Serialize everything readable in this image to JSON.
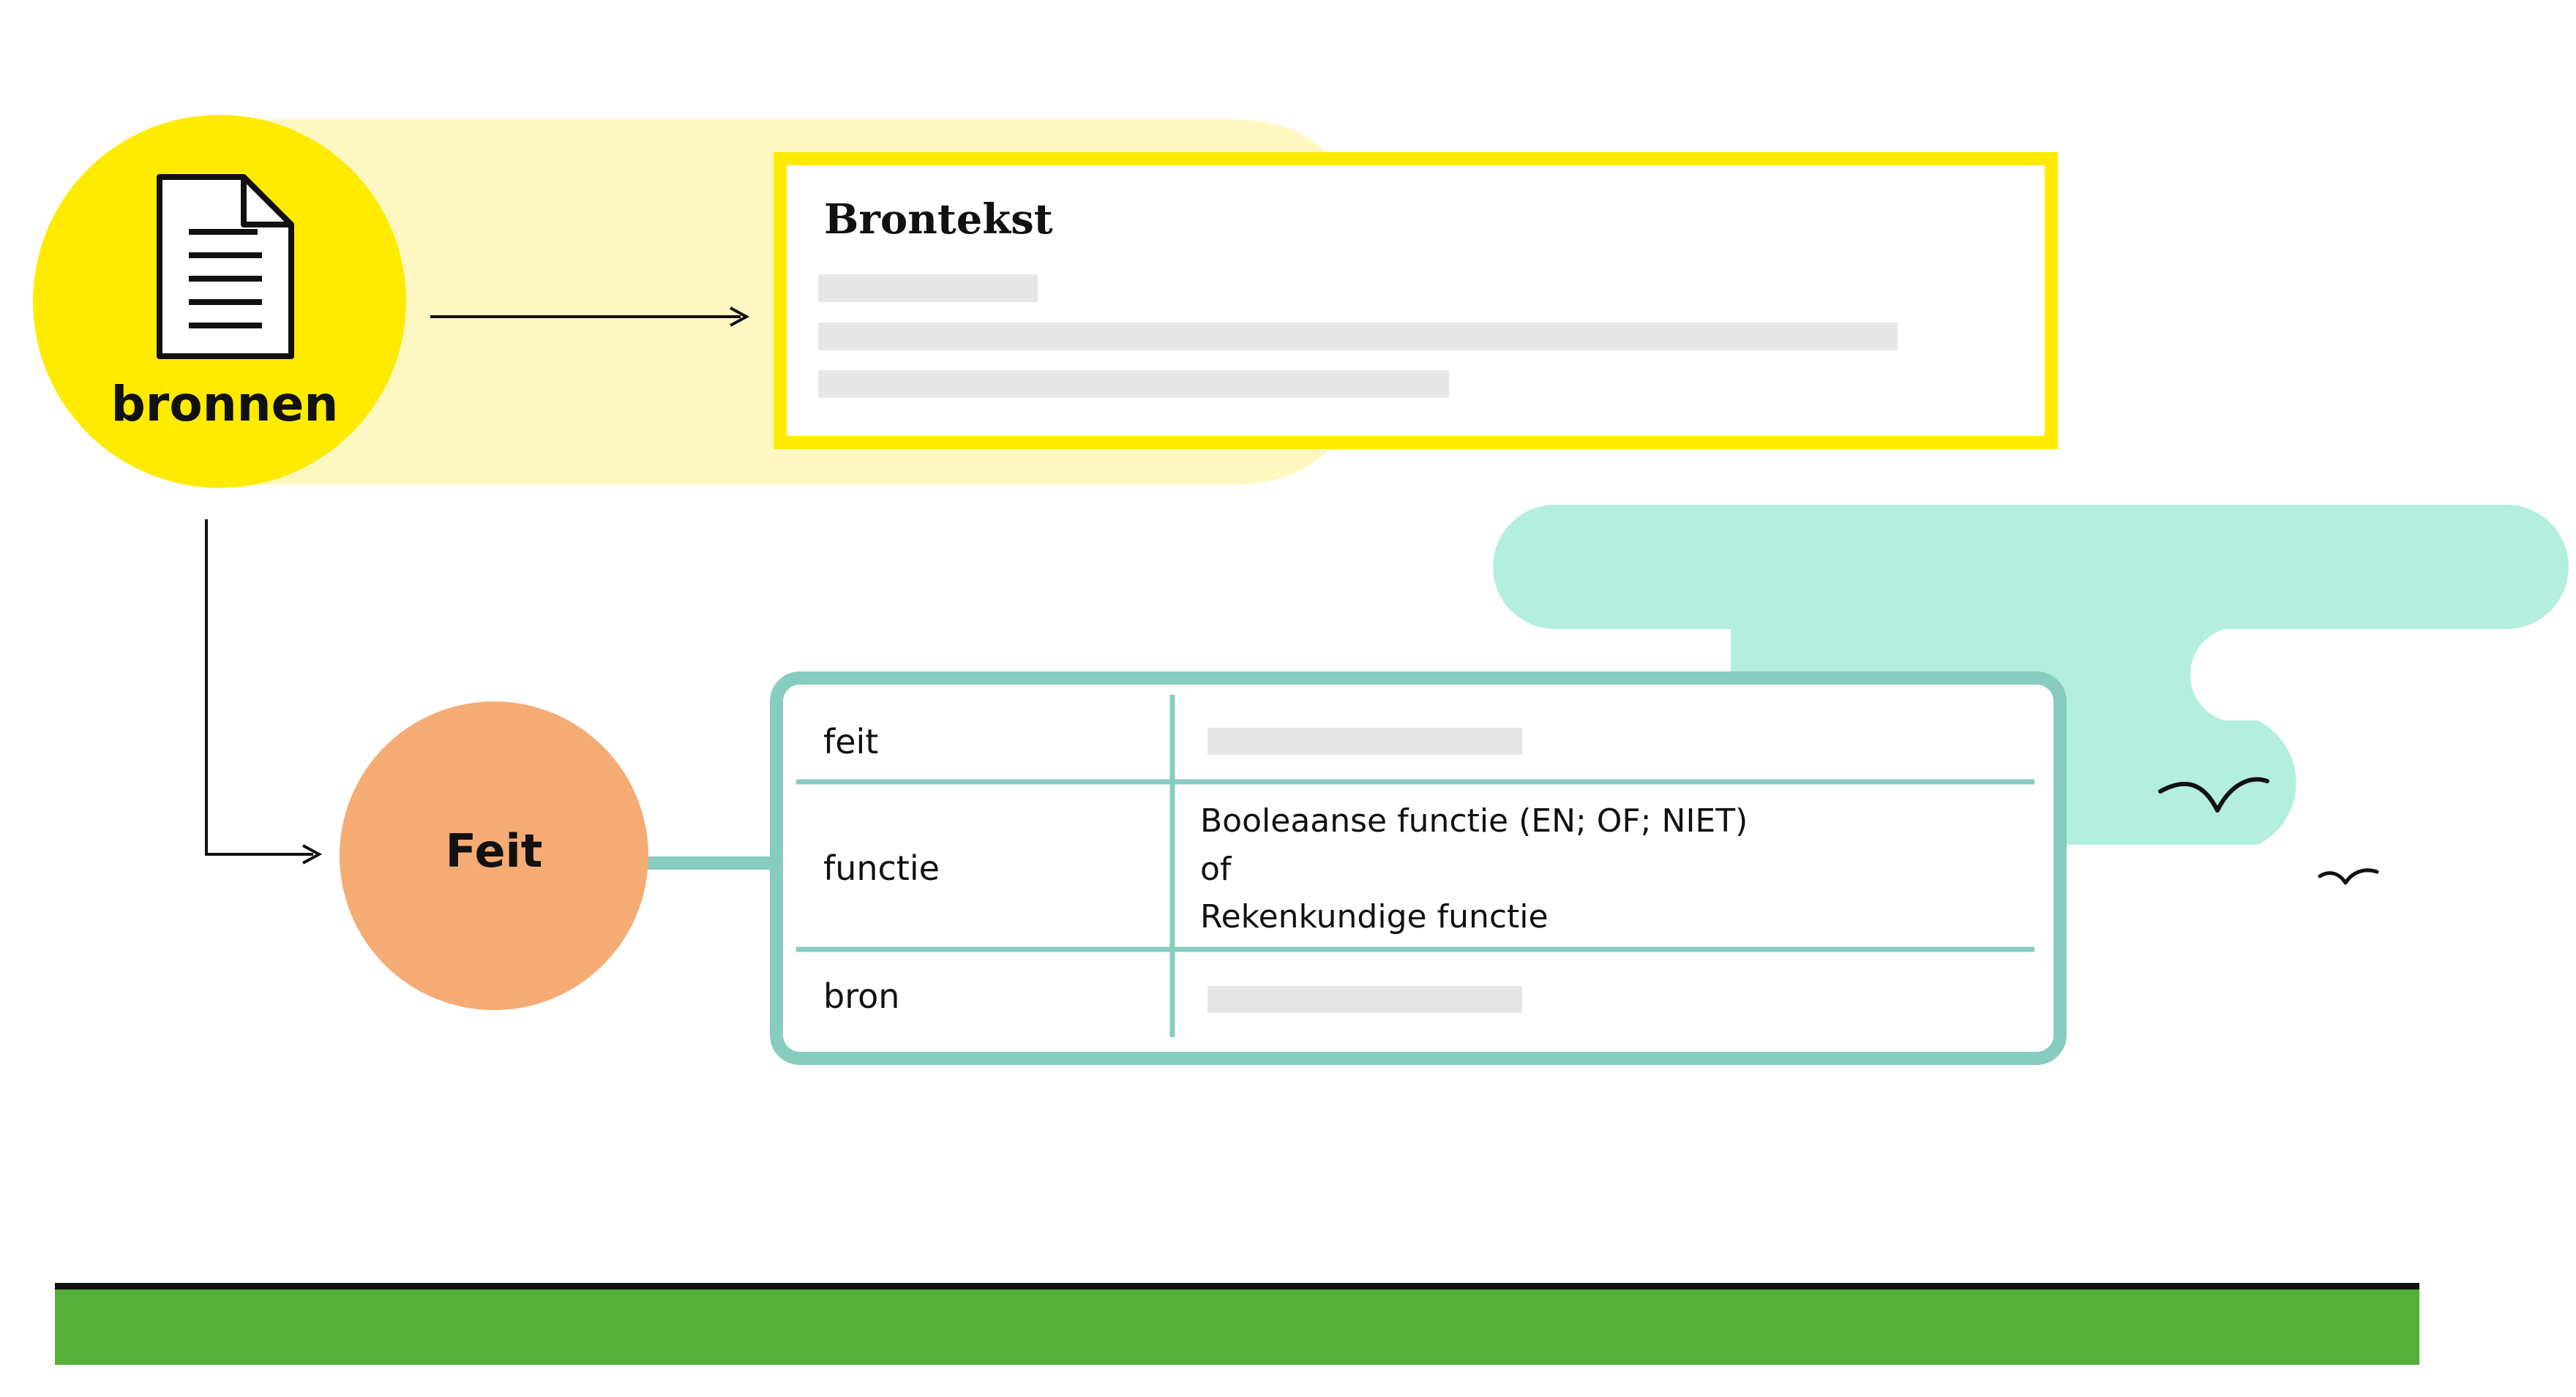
{
  "source_node": {
    "label": "bronnen",
    "icon": "document-icon",
    "fill_color": "#FFEB00",
    "band_color": "#FFF7C2"
  },
  "source_card": {
    "title": "Brontekst",
    "border_color": "#FFEB00",
    "placeholder_color": "#E6E6E6"
  },
  "fact_node": {
    "label": "Feit",
    "fill_color": "#F5AB74"
  },
  "fact_table": {
    "border_color": "#86CCBF",
    "rows": [
      {
        "label": "feit",
        "value_lines": []
      },
      {
        "label": "functie",
        "value_lines": [
          "Booleaanse functie (EN; OF; NIET)",
          "of",
          "Rekenkundige functie"
        ]
      },
      {
        "label": "bron",
        "value_lines": []
      }
    ]
  },
  "decor": {
    "cloud_color": "#B3EEDF",
    "birds": [
      "bird-icon",
      "bird-icon"
    ],
    "ground_color": "#55B03A",
    "ground_edge_color": "#111111"
  }
}
